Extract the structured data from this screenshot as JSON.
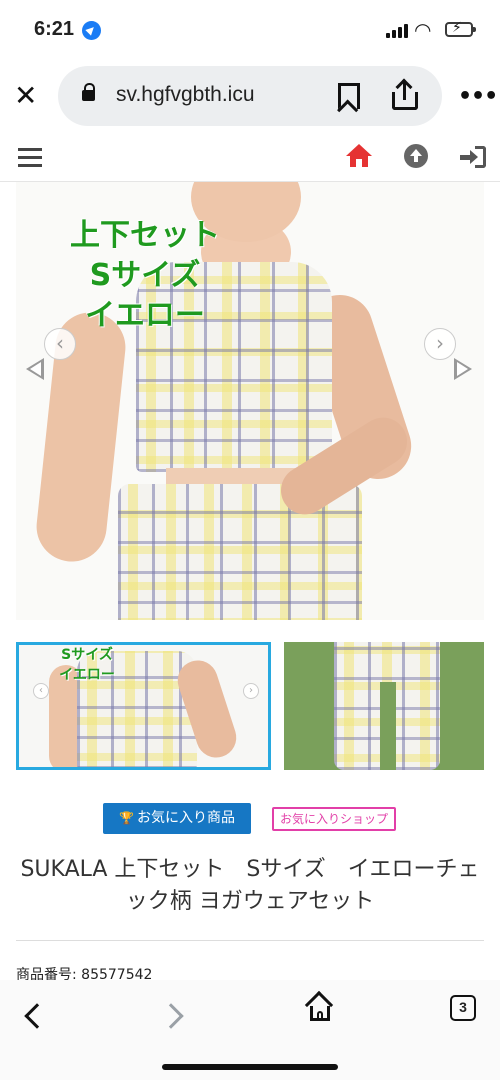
{
  "status_bar": {
    "time": "6:21"
  },
  "browser": {
    "url_display": "sv.hgfvgbth.icu",
    "tab_count": "3"
  },
  "product": {
    "image_overlay_lines": [
      "上下セット",
      "Sサイズ",
      "イエロー"
    ],
    "thumb_overlay_lines": [
      "Sサイズ",
      "イエロー"
    ],
    "fav_product_label": "お気に入り商品",
    "fav_shop_label": "お気に入りショップ",
    "title": "SUKALA 上下セット　Sサイズ　イエローチェック柄 ヨガウェアセット",
    "number_text": "商品番号: 85577542"
  },
  "colors": {
    "accent_blue": "#1677c4",
    "thumb_selected_border": "#28a9e0",
    "shop_pink": "#e23fa8",
    "overlay_green": "#1f9a1f",
    "home_red": "#e53333"
  },
  "icons": {
    "status": [
      "location-arrow-icon",
      "signal-icon",
      "wifi-icon",
      "battery-charging-icon"
    ],
    "browser": [
      "close-icon",
      "lock-icon",
      "bookmark-icon",
      "share-icon",
      "more-icon"
    ],
    "site_nav": [
      "hamburger-menu-icon",
      "home-icon",
      "scroll-up-icon",
      "login-icon"
    ],
    "toolbar": [
      "back-icon",
      "forward-icon",
      "home-icon",
      "tabs-icon"
    ]
  }
}
